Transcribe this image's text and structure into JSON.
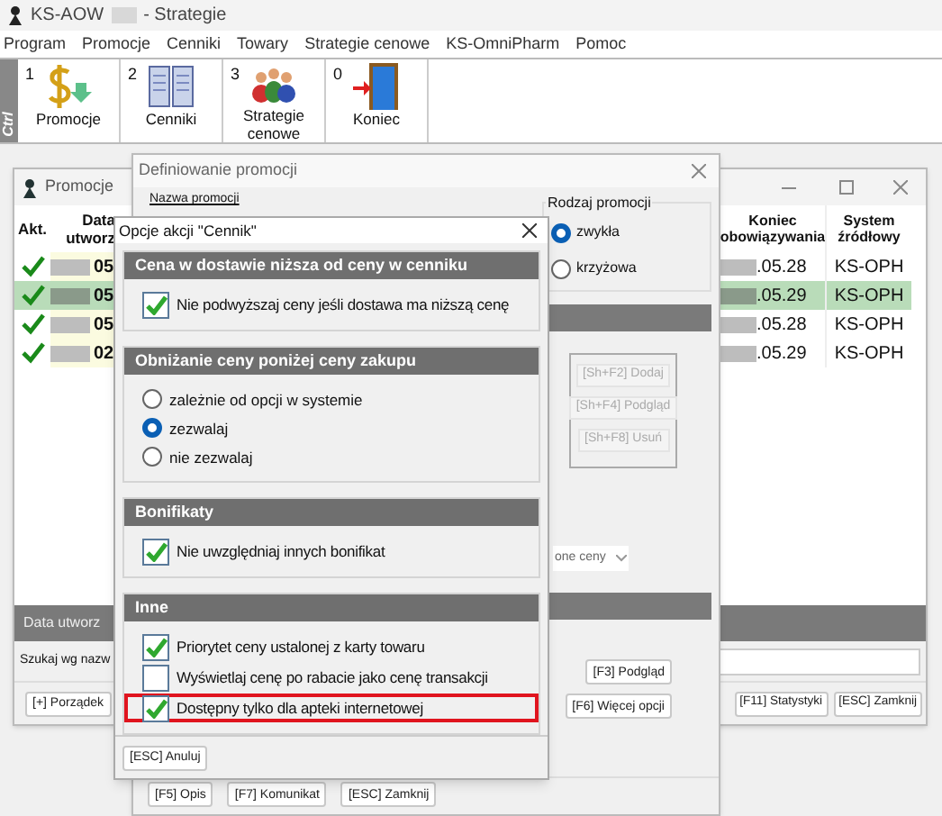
{
  "app": {
    "title_left": "KS-AOW",
    "title_right": "- Strategie"
  },
  "menu": [
    "Program",
    "Promocje",
    "Cenniki",
    "Towary",
    "Strategie cenowe",
    "KS-OmniPharm",
    "Pomoc"
  ],
  "toolbar": {
    "side_label": "Ctrl",
    "buttons": [
      {
        "key": "1",
        "label": "Promocje"
      },
      {
        "key": "2",
        "label": "Cenniki"
      },
      {
        "key": "3",
        "label": "Strategie cenowe"
      },
      {
        "key": "0",
        "label": "Koniec"
      }
    ]
  },
  "promocje_window": {
    "title": "Promocje",
    "columns": [
      "Akt.",
      "Data utworz",
      "Koniec obowiązywania",
      "System źródłowy"
    ],
    "rows": [
      {
        "active": true,
        "selected": false,
        "created": "05",
        "end": ".05.28",
        "system": "KS-OPH"
      },
      {
        "active": true,
        "selected": true,
        "created": "05",
        "end": ".05.29",
        "system": "KS-OPH"
      },
      {
        "active": true,
        "selected": false,
        "created": "05",
        "end": ".05.28",
        "system": "KS-OPH"
      },
      {
        "active": true,
        "selected": false,
        "created": "02",
        "end": ".05.29",
        "system": "KS-OPH"
      }
    ],
    "footer_label": "Data utworz",
    "search_label": "Szukaj wg nazw",
    "left_button": "[+] Porządek",
    "right_buttons": [
      "[F11] Statystyki",
      "[ESC] Zamknij"
    ]
  },
  "definiowanie_window": {
    "title": "Definiowanie promocji",
    "name_label": "Nazwa promocji",
    "type_group": {
      "label": "Rodzaj promocji",
      "options": [
        {
          "label": "zwykła",
          "selected": true
        },
        {
          "label": "krzyżowa",
          "selected": false
        }
      ]
    },
    "side_buttons": [
      {
        "label": "[Sh+F2] Dodaj",
        "disabled": true
      },
      {
        "label": "[Sh+F4] Podgląd",
        "disabled": true
      },
      {
        "label": "[Sh+F8] Usuń",
        "disabled": true
      }
    ],
    "dropdown_value": "one ceny",
    "buttons": [
      "[F3] Podgląd",
      "[F6] Więcej opcji"
    ],
    "bottom_buttons": [
      "[F5] Opis",
      "[F7] Komunikat",
      "[ESC] Zamknij"
    ]
  },
  "dialog": {
    "title": "Opcje akcji \"Cennik\"",
    "sections": [
      {
        "title": "Cena w dostawie niższa od ceny w cenniku",
        "items": [
          {
            "kind": "checkbox",
            "label": "Nie podwyższaj ceny jeśli dostawa ma niższą cenę",
            "checked": true,
            "highlighted": false
          }
        ]
      },
      {
        "title": "Obniżanie ceny poniżej ceny zakupu",
        "items": [
          {
            "kind": "radio",
            "label": "zależnie od opcji w systemie",
            "selected": false
          },
          {
            "kind": "radio",
            "label": "zezwalaj",
            "selected": true
          },
          {
            "kind": "radio",
            "label": "nie zezwalaj",
            "selected": false
          }
        ]
      },
      {
        "title": "Bonifikaty",
        "items": [
          {
            "kind": "checkbox",
            "label": "Nie uwzględniaj innych bonifikat",
            "checked": true,
            "highlighted": false
          }
        ]
      },
      {
        "title": "Inne",
        "items": [
          {
            "kind": "checkbox",
            "label": "Priorytet ceny ustalonej z karty towaru",
            "checked": true,
            "highlighted": false
          },
          {
            "kind": "checkbox",
            "label": "Wyświetlaj cenę po rabacie jako cenę transakcji",
            "checked": false,
            "highlighted": false
          },
          {
            "kind": "checkbox",
            "label": "Dostępny tylko dla apteki internetowej",
            "checked": true,
            "highlighted": true
          }
        ]
      }
    ],
    "button": "[ESC] Anuluj"
  }
}
